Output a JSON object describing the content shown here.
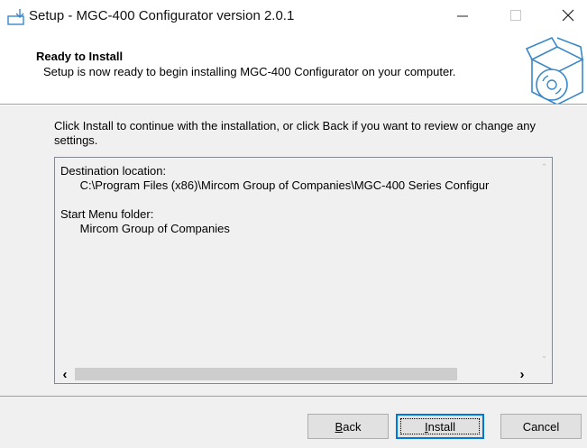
{
  "window": {
    "title": "Setup - MGC-400 Configurator version 2.0.1",
    "icons": [
      "installer-icon",
      "minimize-icon",
      "maximize-icon",
      "close-icon"
    ]
  },
  "header": {
    "title": "Ready to Install",
    "subtitle": "Setup is now ready to begin installing MGC-400 Configurator on your computer.",
    "image": "box-with-disc-icon"
  },
  "main": {
    "intro": "Click Install to continue with the installation, or click Back if you want to review or change any settings.",
    "memo": {
      "destination_label": "Destination location:",
      "destination_value": "C:\\Program Files (x86)\\Mircom Group of Companies\\MGC-400 Series Configur",
      "start_menu_label": "Start Menu folder:",
      "start_menu_value": "Mircom Group of Companies"
    }
  },
  "buttons": {
    "back": {
      "mnemonic": "B",
      "rest": "ack"
    },
    "install": {
      "mnemonic": "I",
      "rest": "nstall"
    },
    "cancel": "Cancel"
  },
  "colors": {
    "focus_border": "#0078d7",
    "panel": "#f0f0f0"
  }
}
